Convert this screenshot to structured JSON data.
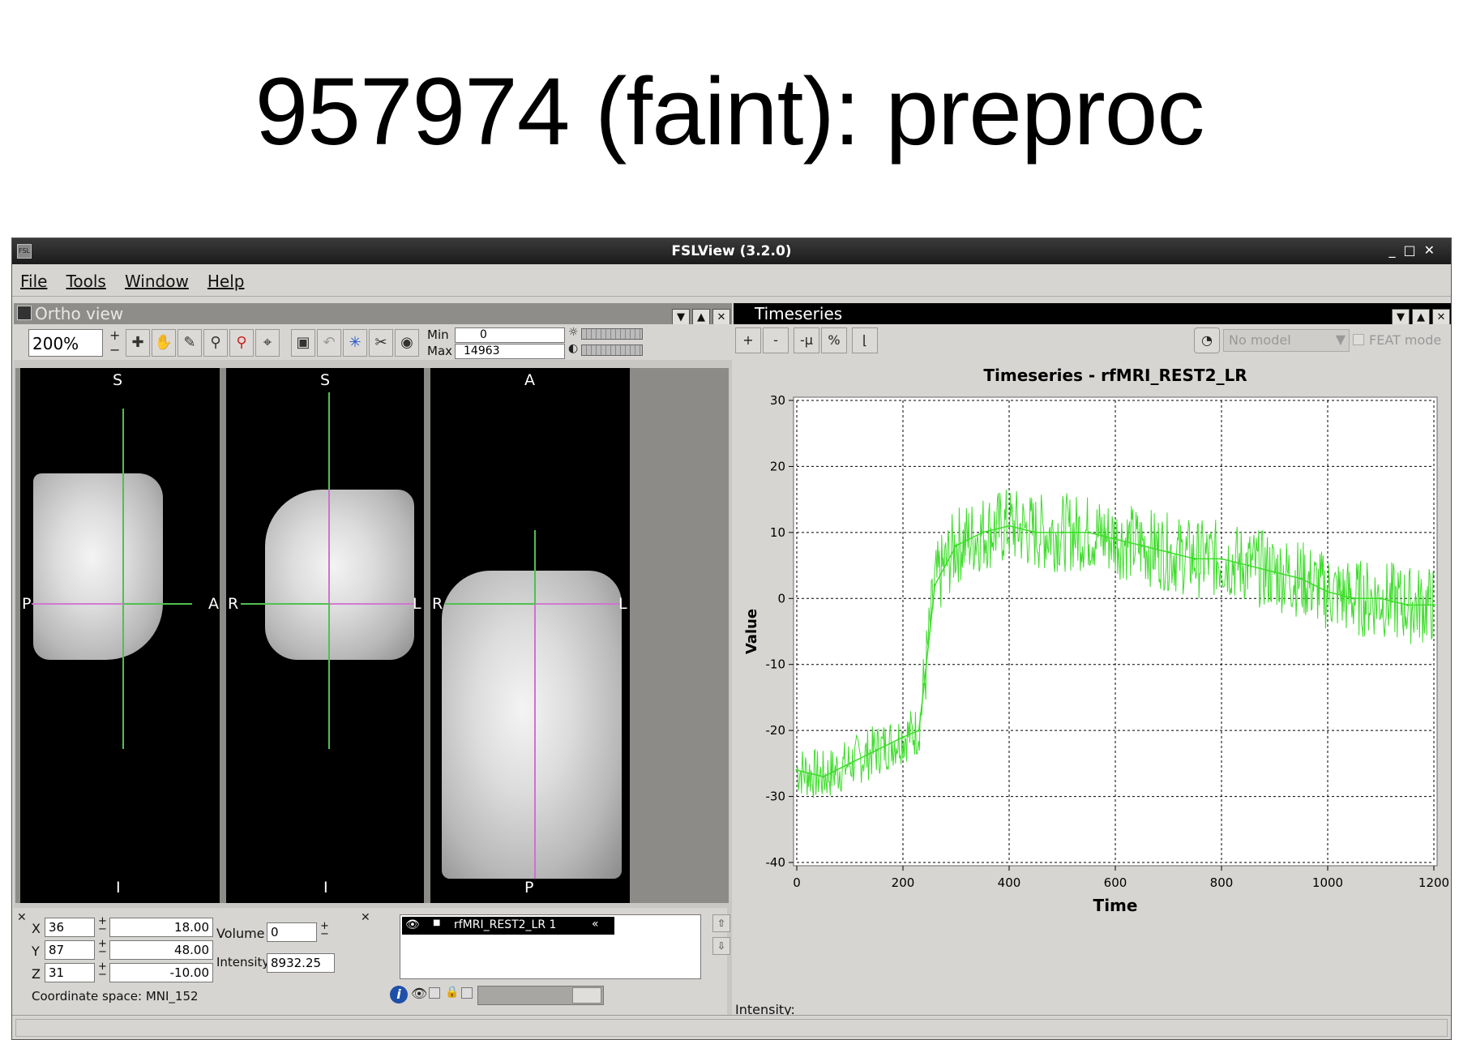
{
  "slide_title": "957974 (faint): preproc",
  "window": {
    "title": "FSLView (3.2.0)",
    "app_icon": "fsl-icon"
  },
  "menu": [
    "File",
    "Tools",
    "Window",
    "Help"
  ],
  "ortho": {
    "title": "Ortho view",
    "zoom": "200%",
    "min_label": "Min",
    "min_value": "0",
    "max_label": "Max",
    "max_value": "14963",
    "views": [
      {
        "name": "sagittal",
        "top": "S",
        "bottom": "I",
        "left": "P",
        "right": "A"
      },
      {
        "name": "coronal",
        "top": "S",
        "bottom": "I",
        "left": "R",
        "right": "L"
      },
      {
        "name": "axial",
        "top": "A",
        "bottom": "P",
        "left": "R",
        "right": "L"
      }
    ]
  },
  "coords": {
    "x_label": "X",
    "x_voxel": "36",
    "x_world": "18.00",
    "y_label": "Y",
    "y_voxel": "87",
    "y_world": "48.00",
    "z_label": "Z",
    "z_voxel": "31",
    "z_world": "-10.00",
    "volume_label": "Volume",
    "volume_value": "0",
    "intensity_label": "Intensity",
    "intensity_value": "8932.25",
    "space": "Coordinate space: MNI_152"
  },
  "layers": [
    {
      "name": "rfMRI_REST2_LR 1"
    }
  ],
  "timeseries": {
    "title": "Timeseries",
    "toolbar": [
      "+",
      "-",
      "-μ",
      "%"
    ],
    "model": "No model",
    "feat_mode": "FEAT mode",
    "intensity_label": "Intensity:"
  },
  "chart_data": {
    "type": "line",
    "title": "Timeseries - rfMRI_REST2_LR",
    "xlabel": "Time",
    "ylabel": "Value",
    "xlim": [
      0,
      1200
    ],
    "ylim": [
      -40,
      30
    ],
    "xticks": [
      0,
      200,
      400,
      600,
      800,
      1000,
      1200
    ],
    "yticks": [
      -40,
      -30,
      -20,
      -10,
      0,
      10,
      20,
      30
    ],
    "grid": true,
    "series": [
      {
        "color": "#3ddc2a",
        "x": [
          0,
          50,
          100,
          150,
          200,
          230,
          240,
          260,
          300,
          350,
          400,
          450,
          500,
          550,
          600,
          650,
          700,
          750,
          800,
          850,
          900,
          950,
          1000,
          1050,
          1100,
          1150,
          1200
        ],
        "values": [
          -26,
          -27,
          -25,
          -23,
          -21,
          -20,
          -13,
          2,
          8,
          10,
          11,
          10,
          10,
          10,
          9,
          8,
          7,
          6,
          6,
          5,
          4,
          3,
          1,
          0,
          0,
          -1,
          -1
        ]
      }
    ]
  }
}
